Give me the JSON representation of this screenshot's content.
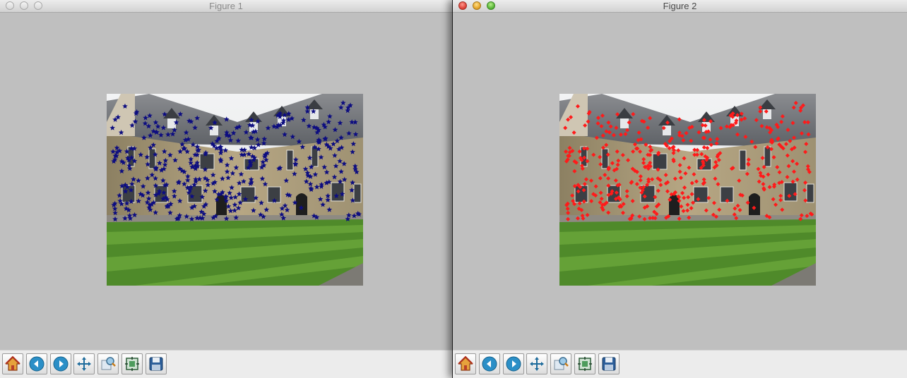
{
  "windows": [
    {
      "title": "Figure 1",
      "focused": false,
      "marker": {
        "shape": "star",
        "color": "#0d0d80"
      }
    },
    {
      "title": "Figure 2",
      "focused": true,
      "marker": {
        "shape": "diamond",
        "color": "#ff1a1a"
      }
    }
  ],
  "toolbar_buttons": [
    {
      "icon": "home-icon"
    },
    {
      "icon": "back-icon"
    },
    {
      "icon": "forward-icon"
    },
    {
      "icon": "pan-icon"
    },
    {
      "icon": "zoom-icon"
    },
    {
      "icon": "subplots-icon"
    },
    {
      "icon": "save-icon"
    }
  ]
}
